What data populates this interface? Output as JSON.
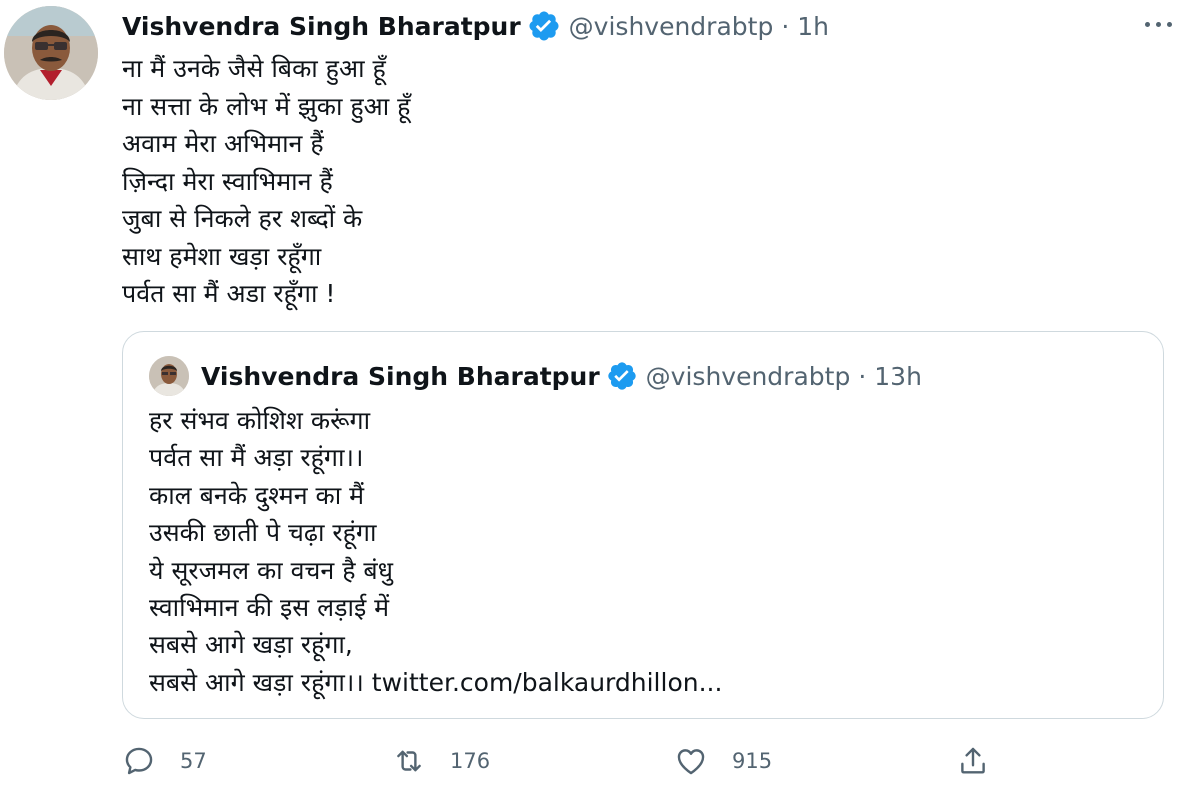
{
  "tweet": {
    "author": {
      "name": "Vishvendra Singh Bharatpur",
      "handle": "@vishvendrabtp",
      "verified": true,
      "time": "1h"
    },
    "lines": [
      "ना मैं उनके जैसे बिका हुआ हूँ",
      "ना सत्ता के लोभ में झुका हुआ हूँ",
      "अवाम मेरा अभिमान हैं",
      "ज़िन्दा मेरा स्वाभिमान हैं",
      "जुबा से निकले हर शब्दों के",
      "साथ हमेशा खड़ा रहूँगा",
      "पर्वत सा मैं अडा रहूँगा !"
    ],
    "quoted": {
      "author": {
        "name": "Vishvendra Singh Bharatpur",
        "handle": "@vishvendrabtp",
        "verified": true,
        "time": "13h"
      },
      "lines": [
        "हर संभव कोशिश करूंगा",
        "पर्वत सा मैं अड़ा रहूंगा।।",
        "काल बनके दुश्मन का मैं",
        "उसकी छाती पे चढ़ा रहूंगा",
        "ये सूरजमल का वचन है बंधु",
        "स्वाभिमान की इस लड़ाई में",
        "सबसे आगे खड़ा रहूंगा,"
      ],
      "last_line": "सबसे आगे खड़ा रहूंगा।।",
      "link": "twitter.com/balkaurdhillon..."
    },
    "actions": {
      "replies": "57",
      "retweets": "176",
      "likes": "915"
    },
    "separator": "·",
    "colors": {
      "verified": "#1d9bf0",
      "text": "#0f1419",
      "muted": "#536471",
      "border": "#cfd9de"
    },
    "icons": [
      "verified-badge-icon",
      "more-icon",
      "reply-icon",
      "retweet-icon",
      "like-icon",
      "share-icon"
    ]
  }
}
